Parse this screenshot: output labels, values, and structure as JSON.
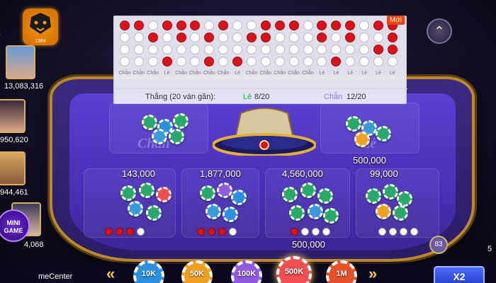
{
  "logo": {
    "year": "1984"
  },
  "players": [
    {
      "balance": "13,083,316"
    },
    {
      "balance": "950,620"
    },
    {
      "balance": "944,461"
    },
    {
      "balance": "4,068"
    }
  ],
  "right_player_balance": "5",
  "mini_game_label": "MINI\nGAME",
  "game_center_label": "meCenter",
  "history": {
    "new_badge": "Mới",
    "columns": [
      {
        "dots": [
          "r",
          "w",
          "w",
          "w"
        ],
        "label": "Chẵn"
      },
      {
        "dots": [
          "r",
          "w",
          "w",
          "w"
        ],
        "label": "Chẵn"
      },
      {
        "dots": [
          "w",
          "r",
          "w",
          "w"
        ],
        "label": "Chẵn"
      },
      {
        "dots": [
          "r",
          "w",
          "w",
          "r"
        ],
        "label": "Lẻ"
      },
      {
        "dots": [
          "r",
          "r",
          "w",
          "w"
        ],
        "label": "Chẵn"
      },
      {
        "dots": [
          "r",
          "w",
          "w",
          "w"
        ],
        "label": "Chẵn"
      },
      {
        "dots": [
          "w",
          "r",
          "w",
          "r"
        ],
        "label": "Chẵn"
      },
      {
        "dots": [
          "r",
          "w",
          "w",
          "w"
        ],
        "label": "Chẵn"
      },
      {
        "dots": [
          "w",
          "w",
          "w",
          "r"
        ],
        "label": "Lẻ"
      },
      {
        "dots": [
          "w",
          "r",
          "w",
          "w"
        ],
        "label": "Chẵn"
      },
      {
        "dots": [
          "r",
          "r",
          "w",
          "w"
        ],
        "label": "Chẵn"
      },
      {
        "dots": [
          "r",
          "w",
          "w",
          "w"
        ],
        "label": "Chẵn"
      },
      {
        "dots": [
          "r",
          "w",
          "w",
          "w"
        ],
        "label": "Chẵn"
      },
      {
        "dots": [
          "w",
          "w",
          "w",
          "w"
        ],
        "label": "Chẵn"
      },
      {
        "dots": [
          "r",
          "r",
          "w",
          "w"
        ],
        "label": "Lẻ"
      },
      {
        "dots": [
          "r",
          "w",
          "w",
          "r"
        ],
        "label": "Lẻ"
      },
      {
        "dots": [
          "r",
          "r",
          "w",
          "w"
        ],
        "label": "Lẻ"
      },
      {
        "dots": [
          "w",
          "w",
          "w",
          "w"
        ],
        "label": "Lẻ"
      },
      {
        "dots": [
          "r",
          "w",
          "r",
          "w"
        ],
        "label": "Lẻ"
      },
      {
        "dots": [
          "r",
          "r",
          "r",
          "w"
        ],
        "label": "Lẻ"
      }
    ],
    "summary_label": "Thắng (20 ván gần):",
    "le_label": "Lẻ",
    "le_value": "8/20",
    "chan_label": "Chẵn",
    "chan_value": "12/20"
  },
  "table": {
    "chan_label": "Chẵn",
    "le_label": "Lẻ",
    "le_amount": "500,000",
    "bets": [
      {
        "amount": "143,000",
        "dots": [
          "r",
          "r",
          "r",
          "w"
        ]
      },
      {
        "amount": "1,877,000",
        "dots": [
          "r",
          "r",
          "r",
          "w"
        ]
      },
      {
        "amount": "4,560,000",
        "dots": [
          "r",
          "w",
          "w",
          "w"
        ],
        "sub_amount": "500,000"
      },
      {
        "amount": "99,000",
        "dots": [
          "w",
          "w",
          "w",
          "w"
        ]
      }
    ],
    "chip_counter": "83"
  },
  "chips": [
    {
      "label": "10K",
      "color": "#2c8fe0"
    },
    {
      "label": "50K",
      "color": "#f0a020"
    },
    {
      "label": "100K",
      "color": "#8d5ae0"
    },
    {
      "label": "500K",
      "color": "#ef4f4f",
      "selected": true
    },
    {
      "label": "1M",
      "color": "#e8502a"
    }
  ],
  "x2_label": "X2",
  "colors": {
    "red": "#d8131b",
    "felt": "#4a2fb8",
    "gold": "#b8892a"
  }
}
